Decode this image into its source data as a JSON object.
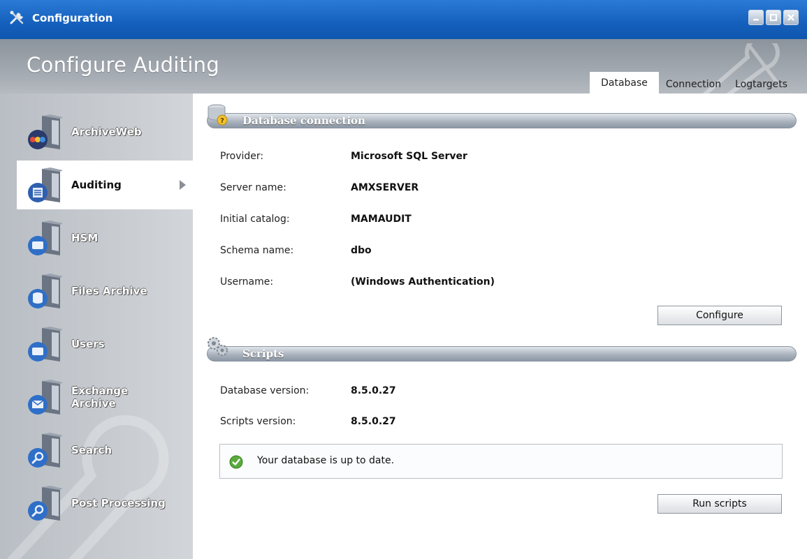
{
  "window": {
    "title": "Configuration",
    "page_title": "Configure Auditing"
  },
  "tabs": [
    {
      "label": "Database",
      "active": true
    },
    {
      "label": "Connection",
      "active": false
    },
    {
      "label": "Logtargets",
      "active": false
    }
  ],
  "sidebar": {
    "items": [
      {
        "label": "ArchiveWeb",
        "icon": "archiveweb-icon"
      },
      {
        "label": "Auditing",
        "icon": "auditing-icon",
        "active": true
      },
      {
        "label": "HSM",
        "icon": "hsm-icon"
      },
      {
        "label": "Files Archive",
        "icon": "files-archive-icon"
      },
      {
        "label": "Users",
        "icon": "users-icon"
      },
      {
        "label": "Exchange Archive",
        "icon": "exchange-archive-icon"
      },
      {
        "label": "Search",
        "icon": "search-icon"
      },
      {
        "label": "Post Processing",
        "icon": "post-processing-icon"
      }
    ]
  },
  "database_connection": {
    "section_title": "Database connection",
    "fields": [
      {
        "label": "Provider:",
        "value": "Microsoft SQL Server"
      },
      {
        "label": "Server name:",
        "value": "AMXSERVER"
      },
      {
        "label": "Initial catalog:",
        "value": "MAMAUDIT"
      },
      {
        "label": "Schema name:",
        "value": "dbo"
      },
      {
        "label": "Username:",
        "value": "(Windows Authentication)"
      }
    ],
    "configure_label": "Configure"
  },
  "scripts": {
    "section_title": "Scripts",
    "fields": [
      {
        "label": "Database version:",
        "value": "8.5.0.27"
      },
      {
        "label": "Scripts version:",
        "value": "8.5.0.27"
      }
    ],
    "status_text": "Your database is up to date.",
    "run_label": "Run scripts"
  },
  "colors": {
    "titlebar": "#1560bd",
    "header": "#9ca2a9",
    "sidebar": "#c4c8cd",
    "status_ok": "#5aaa3c"
  }
}
